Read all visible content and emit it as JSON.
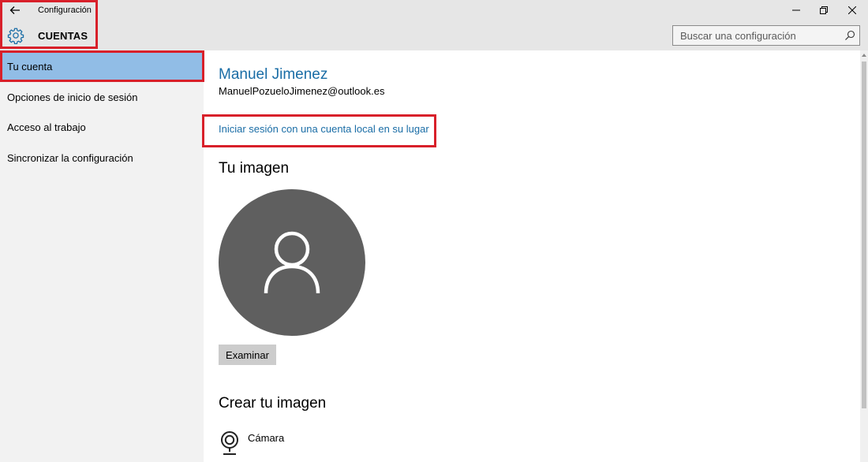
{
  "window": {
    "title": "Configuración",
    "section_title": "CUENTAS",
    "search": {
      "placeholder": "Buscar una configuración",
      "value": ""
    }
  },
  "sidebar": {
    "items": [
      {
        "label": "Tu cuenta",
        "selected": true
      },
      {
        "label": "Opciones de inicio de sesión",
        "selected": false
      },
      {
        "label": "Acceso al trabajo",
        "selected": false
      },
      {
        "label": "Sincronizar la configuración",
        "selected": false
      }
    ]
  },
  "account": {
    "name": "Manuel Jimenez",
    "email": "ManuelPozueloJimenez@outlook.es",
    "local_account_link": "Iniciar sesión con una cuenta local en su lugar"
  },
  "picture": {
    "heading": "Tu imagen",
    "browse_label": "Examinar"
  },
  "create_picture": {
    "heading": "Crear tu imagen",
    "items": [
      {
        "label": "Cámara",
        "icon": "camera-icon"
      }
    ]
  },
  "colors": {
    "accent": "#1a6da6",
    "selected_nav": "#91bde6",
    "annotation": "#d8202a",
    "avatar_bg": "#5f5f5f"
  }
}
